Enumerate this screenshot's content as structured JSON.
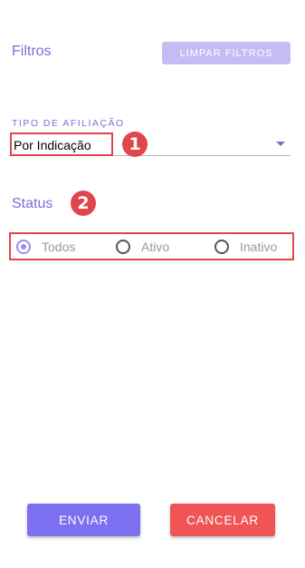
{
  "header": {
    "title": "Filtros",
    "clear_button": "LIMPAR FILTROS"
  },
  "affiliation": {
    "label": "TIPO DE AFILIAÇÃO",
    "selected_value": "Por Indicação"
  },
  "markers": {
    "first": "1",
    "second": "2"
  },
  "status": {
    "label": "Status",
    "options": [
      {
        "label": "Todos",
        "checked": true
      },
      {
        "label": "Ativo",
        "checked": false
      },
      {
        "label": "Inativo",
        "checked": false
      }
    ]
  },
  "actions": {
    "send": "ENVIAR",
    "cancel": "CANCELAR"
  },
  "colors": {
    "accent": "#7b6fd6",
    "highlight": "#e0474c",
    "send_button": "#7d70f0",
    "cancel_button": "#f05454"
  }
}
